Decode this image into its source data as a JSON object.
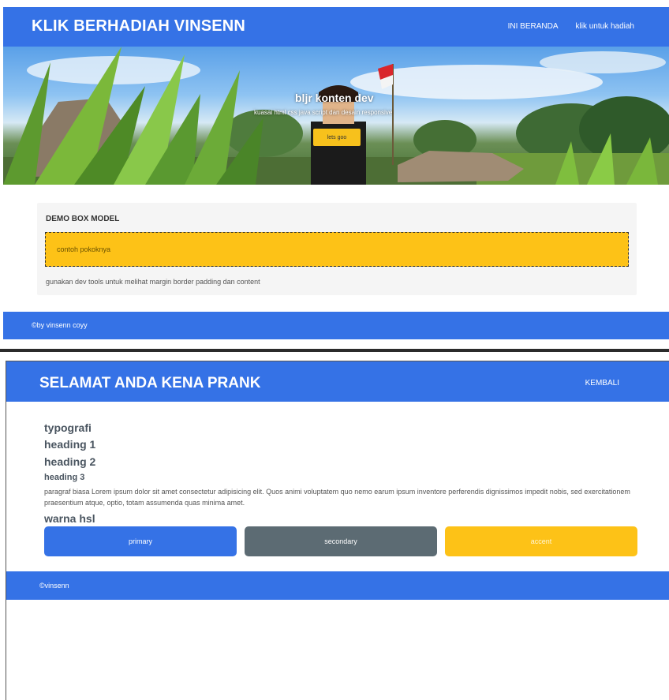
{
  "page1": {
    "nav": {
      "brand": "KLIK BERHADIAH VINSENN",
      "links": [
        "INI BERANDA",
        "klik untuk hadiah"
      ]
    },
    "hero": {
      "title": "bljr konten dev",
      "subtitle": "kuasai html css java script dan desain responsive",
      "button": "lets goo"
    },
    "demo": {
      "title": "DEMO BOX MODEL",
      "box_text": "contoh pokoknya",
      "note": "gunakan dev tools untuk melihat margin border padding dan content"
    },
    "footer": "©by vinsenn coyy"
  },
  "page2": {
    "nav": {
      "brand": "SELAMAT ANDA KENA PRANK",
      "back": "KEMBALI"
    },
    "typography": {
      "title": "typografi",
      "h1": "heading 1",
      "h2": "heading 2",
      "h3": "heading 3",
      "paragraph": "paragraf biasa Lorem ipsum dolor sit amet consectetur adipisicing elit. Quos animi voluptatem quo nemo earum ipsum inventore perferendis dignissimos impedit nobis, sed exercitationem praesentium atque, optio, totam assumenda quas minima amet."
    },
    "colors_title": "warna hsl",
    "swatches": [
      {
        "label": "primary",
        "color": "#3572e6"
      },
      {
        "label": "secondary",
        "color": "#5c6b73"
      },
      {
        "label": "accent",
        "color": "#fdc217"
      }
    ],
    "footer": "©vinsenn"
  },
  "colors": {
    "brand_blue": "#3572e6",
    "accent_yellow": "#fdc217",
    "secondary_gray": "#5c6b73"
  }
}
